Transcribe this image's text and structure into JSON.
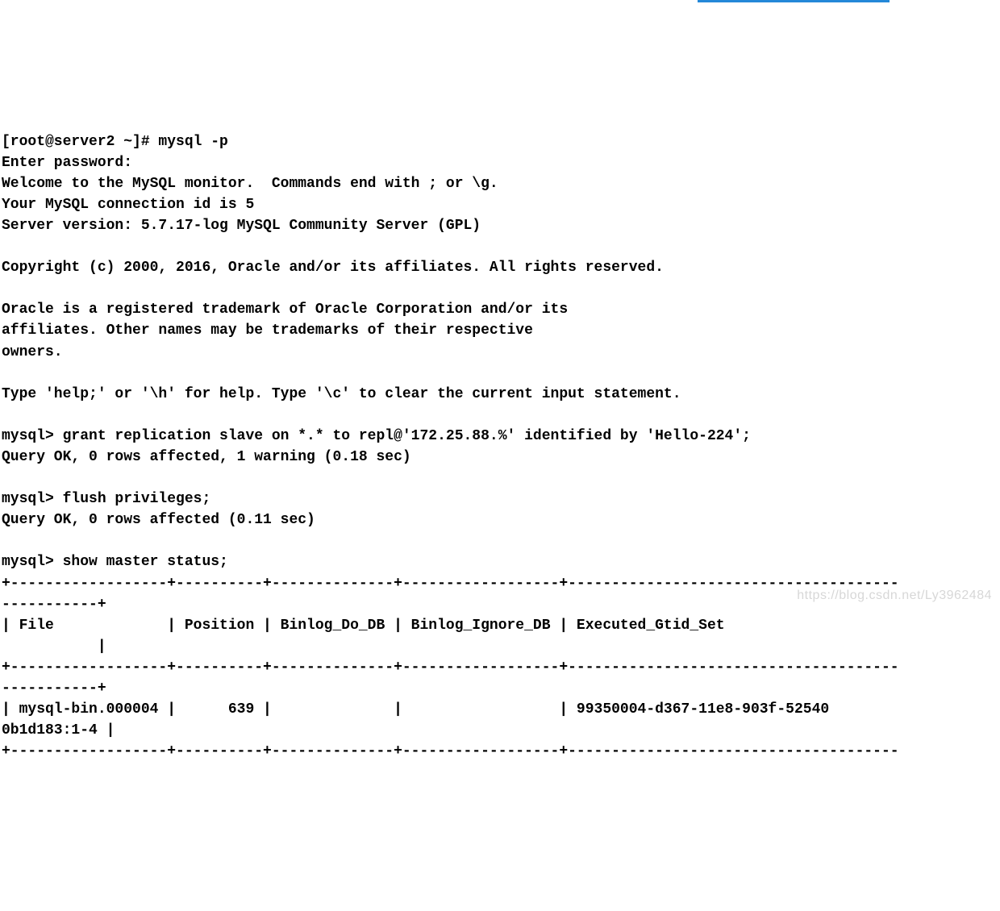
{
  "prompt_line": "[root@server2 ~]# mysql -p",
  "enter_password": "Enter password:",
  "welcome_l1": "Welcome to the MySQL monitor.  Commands end with ; or \\g.",
  "welcome_l2": "Your MySQL connection id is 5",
  "welcome_l3": "Server version: 5.7.17-log MySQL Community Server (GPL)",
  "copyright": "Copyright (c) 2000, 2016, Oracle and/or its affiliates. All rights reserved.",
  "trademark_l1": "Oracle is a registered trademark of Oracle Corporation and/or its",
  "trademark_l2": "affiliates. Other names may be trademarks of their respective",
  "trademark_l3": "owners.",
  "help_line": "Type 'help;' or '\\h' for help. Type '\\c' to clear the current input statement.",
  "cmd1_prompt": "mysql> grant replication slave on *.* to repl@'172.25.88.%' identified by 'Hello-224';",
  "cmd1_result": "Query OK, 0 rows affected, 1 warning (0.18 sec)",
  "cmd2_prompt": "mysql> flush privileges;",
  "cmd2_result": "Query OK, 0 rows affected (0.11 sec)",
  "cmd3_prompt": "mysql> show master status;",
  "table_border_top_l1": "+------------------+----------+--------------+------------------+--------------------------------------",
  "table_border_top_l2": "-----------+",
  "table_header_l1": "| File             | Position | Binlog_Do_DB | Binlog_Ignore_DB | Executed_Gtid_Set                    ",
  "table_header_l2": "           |",
  "table_border_mid_l1": "+------------------+----------+--------------+------------------+--------------------------------------",
  "table_border_mid_l2": "-----------+",
  "table_row_l1": "| mysql-bin.000004 |      639 |              |                  | 99350004-d367-11e8-903f-52540",
  "table_row_l2": "0b1d183:1-4 |",
  "table_border_bot_l1": "+------------------+----------+--------------+------------------+--------------------------------------",
  "watermark": "https://blog.csdn.net/Ly3962484"
}
